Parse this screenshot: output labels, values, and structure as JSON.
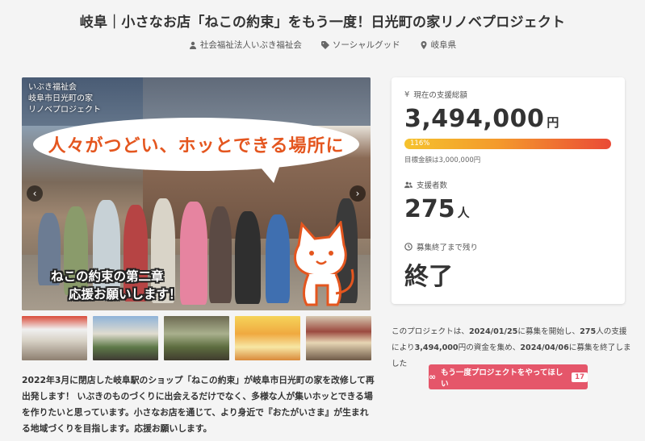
{
  "page": {
    "title": "岐阜｜小さなお店「ねこの約束」をもう一度！日光町の家リノベプロジェクト"
  },
  "meta": {
    "organizer": "社会福祉法人いぶき福祉会",
    "category": "ソーシャルグッド",
    "location": "岐阜県"
  },
  "photo": {
    "org_tag_line1": "いぶき福祉会",
    "org_tag_line2": "岐阜市日光町の家",
    "org_tag_line3": "リノベプロジェクト",
    "bubble_text": "人々がつどい、ホッとできる場所に",
    "cta_line1": "ねこの約束の第二章",
    "cta_line2": "応援お願いします！"
  },
  "description": "2022年3月に閉店した岐阜駅のショップ「ねこの約束」が岐阜市日光町の家を改修して再出発します！ いぶきのものづくりに出会えるだけでなく、多様な人が集いホッとできる場を作りたいと思っています。小さなお店を通じて、より身近で『おたがいさま』が生まれる地域づくりを目指します。応援お願いします。",
  "funding": {
    "total_label": "現在の支援総額",
    "total_amount": "3,494,000",
    "total_unit": "円",
    "progress_text": "116%",
    "progress_percent": 116,
    "target_text": "目標金額は3,000,000円",
    "supporters_label": "支援者数",
    "supporters_count": "275",
    "supporters_unit": "人",
    "remaining_label": "募集終了まで残り",
    "remaining_value": "終了"
  },
  "summary": {
    "part1": "このプロジェクトは、",
    "start_date": "2024/01/25",
    "part2": "に募集を開始し、",
    "supporters": "275",
    "part3": "人の支援により",
    "amount": "3,494,000",
    "part4": "円の資金を集め、",
    "end_date": "2024/04/06",
    "part5": "に募集を終了しました"
  },
  "again_button": {
    "label": "もう一度プロジェクトをやってほしい",
    "count": "17"
  },
  "colors": {
    "accent": "#e5566a",
    "bubble_text": "#e4561f",
    "progress_start": "#f5c22d",
    "progress_end": "#ea4a36"
  }
}
